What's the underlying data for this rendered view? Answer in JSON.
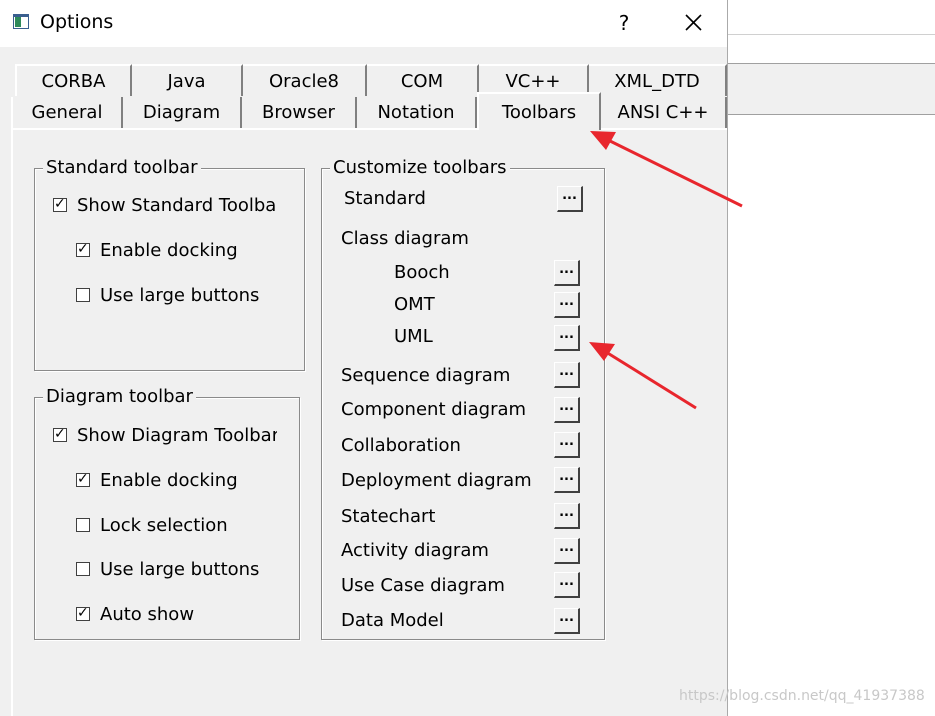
{
  "window": {
    "title": "Options",
    "help_label": "?"
  },
  "tabs": {
    "row1": [
      "CORBA",
      "Java",
      "Oracle8",
      "COM",
      "VC++",
      "XML_DTD"
    ],
    "row2": [
      "General",
      "Diagram",
      "Browser",
      "Notation",
      "Toolbars",
      "ANSI C++"
    ],
    "active": "Toolbars"
  },
  "standard_toolbar": {
    "title": "Standard toolbar",
    "show": {
      "label": "Show Standard Toolba",
      "checked": true
    },
    "docking": {
      "label": "Enable docking",
      "checked": true
    },
    "large": {
      "label": "Use large buttons",
      "checked": false
    }
  },
  "diagram_toolbar": {
    "title": "Diagram toolbar",
    "show": {
      "label": "Show Diagram Toolbar",
      "checked": true
    },
    "docking": {
      "label": "Enable docking",
      "checked": true
    },
    "lock": {
      "label": "Lock selection",
      "checked": false
    },
    "large": {
      "label": "Use large buttons",
      "checked": false
    },
    "auto": {
      "label": "Auto show",
      "checked": true
    }
  },
  "customize": {
    "title": "Customize toolbars",
    "button_label": "...",
    "standard": "Standard",
    "class_diagram": "Class diagram",
    "booch": "Booch",
    "omt": "OMT",
    "uml": "UML",
    "sequence": "Sequence diagram",
    "component": "Component diagram",
    "collaboration": "Collaboration",
    "deployment": "Deployment diagram",
    "statechart": "Statechart",
    "activity": "Activity diagram",
    "usecase": "Use Case diagram",
    "datamodel": "Data Model"
  },
  "watermark": "https://blog.csdn.net/qq_41937388",
  "colors": {
    "arrow": "#e8262d",
    "dialog_bg": "#f0f0f0"
  }
}
